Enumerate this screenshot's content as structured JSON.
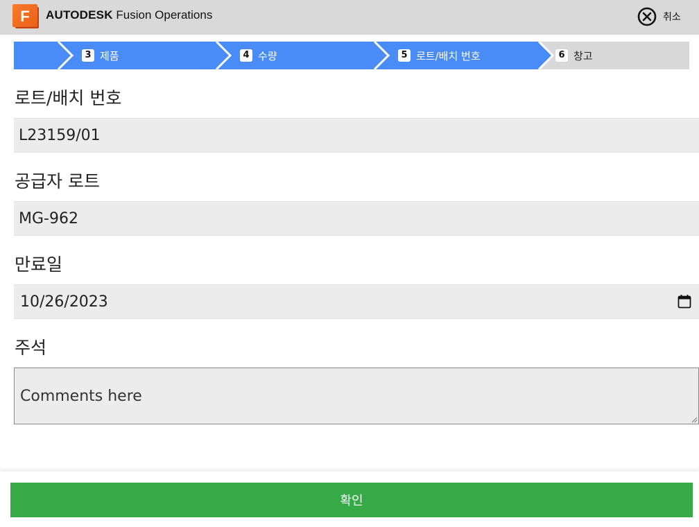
{
  "header": {
    "logo_letter": "F",
    "brand_strong": "AUTODESK",
    "brand_light": "Fusion Operations",
    "cancel_label": "취소"
  },
  "steps": [
    {
      "number": "3",
      "label": "제품",
      "state": "done"
    },
    {
      "number": "4",
      "label": "수량",
      "state": "done"
    },
    {
      "number": "5",
      "label": "로트/배치 번호",
      "state": "current"
    },
    {
      "number": "6",
      "label": "창고",
      "state": "upcoming"
    }
  ],
  "form": {
    "lot": {
      "label": "로트/배치 번호",
      "value": "L23159/01"
    },
    "supplier_lot": {
      "label": "공급자 로트",
      "value": "MG-962"
    },
    "expiry": {
      "label": "만료일",
      "value": "10/26/2023"
    },
    "notes": {
      "label": "주석",
      "placeholder": "Comments here"
    }
  },
  "footer": {
    "confirm_label": "확인"
  },
  "colors": {
    "step_active": "#4a8cf7",
    "step_inactive": "#d8d8d8",
    "confirm": "#37aa48",
    "topbar": "#d9d9d9",
    "logo": "#f26b1d"
  }
}
